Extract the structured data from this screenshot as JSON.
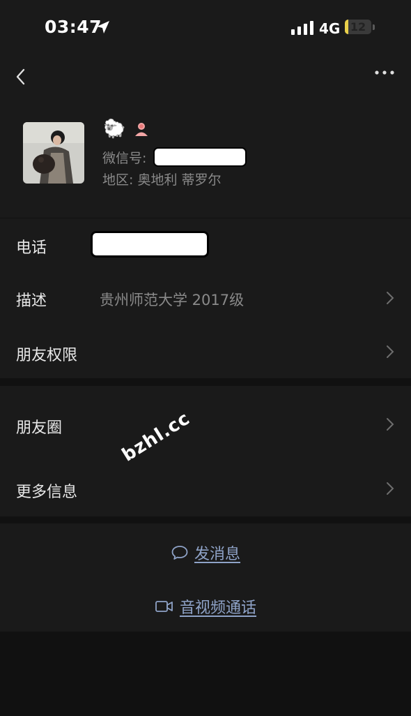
{
  "status_bar": {
    "time": "03:47",
    "network": "4G",
    "battery_level": "12",
    "battery_fraction": 0.12,
    "battery_color": "#e9d04a",
    "icons": [
      "location-arrow-icon",
      "signal-bars-icon",
      "battery-icon"
    ]
  },
  "nav": {
    "back_icon": "chevron-left-icon",
    "more_icon": "more-dots-icon"
  },
  "profile": {
    "nickname_emoji": "🐑",
    "gender_icon": "female-icon",
    "wechat_id_label": "微信号:",
    "region": "地区: 奥地利 蒂罗尔"
  },
  "info": {
    "phone_label": "电话",
    "description_label": "描述",
    "description_value": "贵州师范大学 2017级",
    "permissions_label": "朋友权限"
  },
  "moments": {
    "moments_label": "朋友圈",
    "more_info_label": "更多信息"
  },
  "actions": {
    "message_label": "发消息",
    "call_label": "音视频通话",
    "link_color": "#8fa3c8"
  },
  "watermark": "bzhl.cc"
}
